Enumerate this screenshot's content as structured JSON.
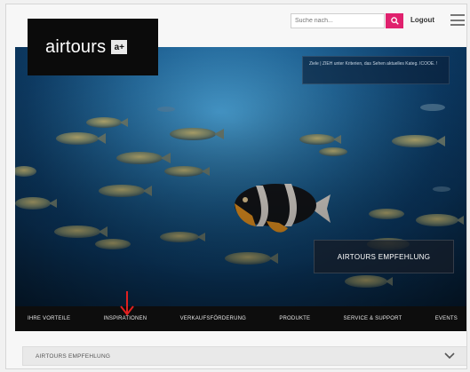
{
  "header": {
    "logo_text": "airtours",
    "logo_badge": "a+",
    "search_placeholder": "Suche nach...",
    "logout_label": "Logout"
  },
  "hero": {
    "info_text": "Ziele | ZIEH unter Kriterien, das Sehen aktuelles Kateg. ICOOE. !",
    "recommend_label": "AIRTOURS EMPFEHLUNG"
  },
  "nav": {
    "items": [
      "IHRE VORTEILE",
      "INSPIRATIONEN",
      "VERKAUFSFÖRDERUNG",
      "PRODUKTE",
      "SERVICE & SUPPORT",
      "EVENTS"
    ]
  },
  "accordion": {
    "label": "AIRTOURS EMPFEHLUNG"
  },
  "icons": {
    "search": "search-icon",
    "menu": "hamburger-menu-icon",
    "arrow": "red-arrow-icon",
    "chevron": "chevron-down-icon"
  },
  "colors": {
    "accent": "#e0216e",
    "nav_bg": "#0d0d0d",
    "arrow": "#e02020"
  }
}
